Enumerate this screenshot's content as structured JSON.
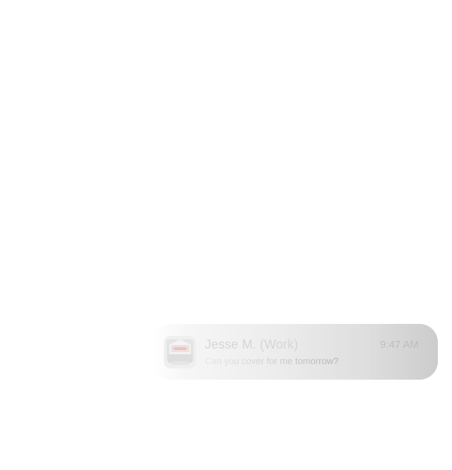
{
  "notification": {
    "app_icon": "message-app-icon",
    "sender": "Jesse M. (Work)",
    "time": "9:47 AM",
    "message": "Can you cover for me tomorrow?"
  },
  "colors": {
    "background": "#ffffff",
    "banner_light": "#ffffff",
    "banner_dark": "#cccccc",
    "icon_accent": "#e9c3c3"
  }
}
